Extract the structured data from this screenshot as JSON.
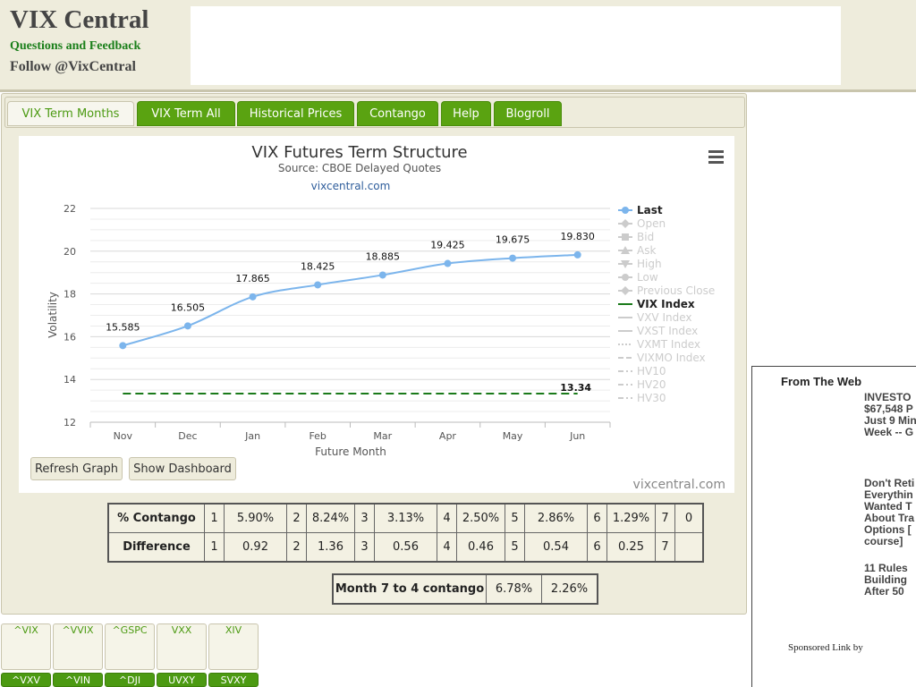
{
  "header": {
    "logo": "VIX Central",
    "feedback": "Questions and Feedback",
    "follow": "Follow @VixCentral"
  },
  "tabs": [
    {
      "label": "VIX Term Months",
      "active": true
    },
    {
      "label": "VIX Term All",
      "active": false
    },
    {
      "label": "Historical Prices",
      "active": false
    },
    {
      "label": "Contango",
      "active": false
    },
    {
      "label": "Help",
      "active": false
    },
    {
      "label": "Blogroll",
      "active": false
    }
  ],
  "chart_data": {
    "type": "line",
    "title": "VIX Futures Term Structure",
    "subtitle": "Source: CBOE Delayed Quotes",
    "subtitle_link": "vixcentral.com",
    "xlabel": "Future Month",
    "ylabel": "Volatility",
    "categories": [
      "Nov",
      "Dec",
      "Jan",
      "Feb",
      "Mar",
      "Apr",
      "May",
      "Jun"
    ],
    "ylim": [
      12,
      22
    ],
    "yticks": [
      12,
      14,
      16,
      18,
      20,
      22
    ],
    "series": [
      {
        "name": "Last",
        "values": [
          15.585,
          16.505,
          17.865,
          18.425,
          18.885,
          19.425,
          19.675,
          19.83
        ],
        "labels": [
          "15.585",
          "16.505",
          "17.865",
          "18.425",
          "18.885",
          "19.425",
          "19.675",
          "19.830"
        ],
        "color": "#7cb5ec"
      },
      {
        "name": "VIX Index",
        "values": [
          13.34,
          13.34,
          13.34,
          13.34,
          13.34,
          13.34,
          13.34,
          13.34
        ],
        "end_label": "13.34",
        "color": "#1a7a1a",
        "dash": true
      }
    ],
    "legend_position": "right",
    "legend": [
      {
        "name": "Last",
        "active": true,
        "marker": "circle"
      },
      {
        "name": "Open",
        "active": false,
        "marker": "diamond"
      },
      {
        "name": "Bid",
        "active": false,
        "marker": "square"
      },
      {
        "name": "Ask",
        "active": false,
        "marker": "triangle"
      },
      {
        "name": "High",
        "active": false,
        "marker": "triangle-down"
      },
      {
        "name": "Low",
        "active": false,
        "marker": "circle"
      },
      {
        "name": "Previous Close",
        "active": false,
        "marker": "diamond"
      },
      {
        "name": "VIX Index",
        "active": true,
        "marker": "line"
      },
      {
        "name": "VXV Index",
        "active": false,
        "marker": "line"
      },
      {
        "name": "VXST Index",
        "active": false,
        "marker": "line"
      },
      {
        "name": "VXMT Index",
        "active": false,
        "marker": "dotted"
      },
      {
        "name": "VIXMO Index",
        "active": false,
        "marker": "dashed"
      },
      {
        "name": "HV10",
        "active": false,
        "marker": "dashdot"
      },
      {
        "name": "HV20",
        "active": false,
        "marker": "dashdot"
      },
      {
        "name": "HV30",
        "active": false,
        "marker": "dashdot"
      }
    ],
    "credit": "vixcentral.com"
  },
  "buttons": {
    "refresh": "Refresh Graph",
    "dashboard": "Show Dashboard"
  },
  "contango_table": {
    "rows": [
      {
        "label": "% Contango",
        "cells": [
          "1",
          "5.90%",
          "2",
          "8.24%",
          "3",
          "3.13%",
          "4",
          "2.50%",
          "5",
          "2.86%",
          "6",
          "1.29%",
          "7",
          "0"
        ]
      },
      {
        "label": "Difference",
        "cells": [
          "1",
          "0.92",
          "2",
          "1.36",
          "3",
          "0.56",
          "4",
          "0.46",
          "5",
          "0.54",
          "6",
          "0.25",
          "7",
          ""
        ]
      }
    ]
  },
  "month74": {
    "label": "Month 7 to 4 contango",
    "v1": "6.78%",
    "v2": "2.26%"
  },
  "side_ad": {
    "heading": "From The Web",
    "items": [
      {
        "lines": [
          "INVESTO",
          "$67,548 P",
          "Just 9 Min",
          "Week -- G"
        ]
      },
      {
        "lines": [
          "Don't Reti",
          "Everythin",
          "Wanted T",
          "About Tra",
          "Options [",
          "course]"
        ]
      },
      {
        "lines": [
          "11 Rules ",
          "Building ",
          "After 50"
        ]
      }
    ],
    "sponsored": "Sponsored Link by"
  },
  "tickers_top": [
    "^VIX",
    "^VVIX",
    "^GSPC",
    "VXX",
    "XIV"
  ],
  "tickers_bottom": [
    "^VXV",
    "^VIN",
    "^DJI",
    "UVXY",
    "SVXY"
  ]
}
